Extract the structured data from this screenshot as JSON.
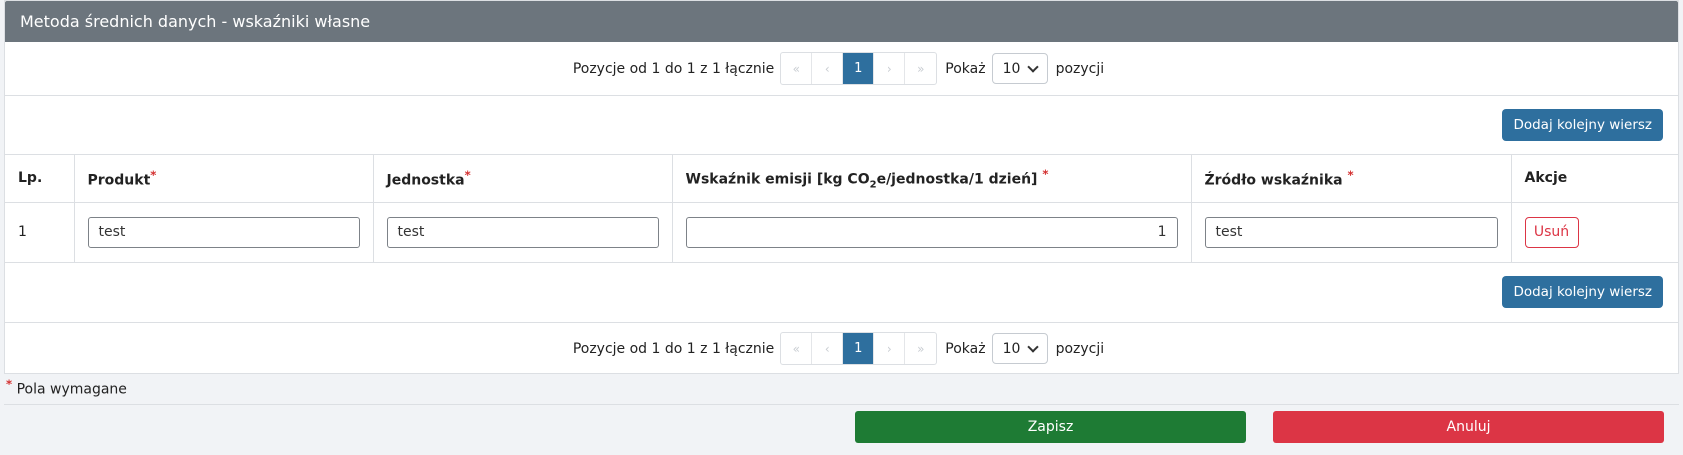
{
  "panel": {
    "title": "Metoda średnich danych - wskaźniki własne"
  },
  "pagination": {
    "summary": "Pozycje od 1 do 1 z 1 łącznie",
    "first_icon": "double-chevron-left-icon",
    "prev_icon": "chevron-left-icon",
    "current_page": "1",
    "next_icon": "chevron-right-icon",
    "last_icon": "double-chevron-right-icon",
    "show_label": "Pokaż",
    "page_size": "10",
    "suffix": "pozycji"
  },
  "actions": {
    "add_row_label": "Dodaj kolejny wiersz"
  },
  "table": {
    "headers": {
      "lp": "Lp.",
      "product": "Produkt",
      "unit": "Jednostka",
      "emission_pre": "Wskaźnik emisji [kg CO",
      "emission_sub": "2",
      "emission_post": "e/jednostka/1 dzień]",
      "source": "Źródło wskaźnika",
      "actions": "Akcje"
    },
    "required_mark": "*",
    "rows": [
      {
        "lp": "1",
        "product": "test",
        "unit": "test",
        "emission": "1",
        "source": "test",
        "delete_label": "Usuń"
      }
    ]
  },
  "footer": {
    "required_note": "Pola wymagane",
    "save_label": "Zapisz",
    "cancel_label": "Anuluj"
  }
}
